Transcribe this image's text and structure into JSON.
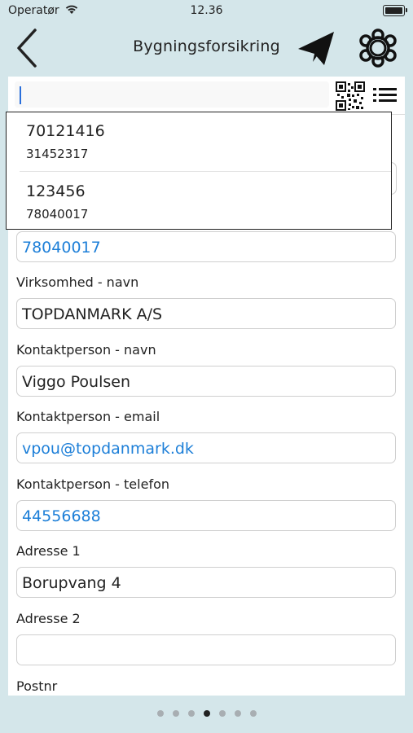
{
  "status_bar": {
    "carrier": "Operatør",
    "time": "12.36"
  },
  "nav": {
    "title": "Bygningsforsikring",
    "back_icon": "chevron-left-icon",
    "send_icon": "paper-plane-icon",
    "settings_icon": "gear-icon"
  },
  "search": {
    "value": "",
    "qr_icon": "qr-code-icon",
    "list_icon": "list-icon"
  },
  "dropdown": {
    "items": [
      {
        "main": "70121416",
        "sub": "31452317"
      },
      {
        "main": "123456",
        "sub": "78040017"
      }
    ]
  },
  "form": {
    "cvr_value": "78040017",
    "company_name_label": "Virksomhed - navn",
    "company_name_value": "TOPDANMARK A/S",
    "contact_name_label": "Kontaktperson - navn",
    "contact_name_value": "Viggo Poulsen",
    "contact_email_label": "Kontaktperson - email",
    "contact_email_value": "vpou@topdanmark.dk",
    "contact_phone_label": "Kontaktperson - telefon",
    "contact_phone_value": "44556688",
    "address1_label": "Adresse 1",
    "address1_value": "Borupvang 4",
    "address2_label": "Adresse 2",
    "address2_value": "",
    "postnr_label": "Postnr"
  },
  "page_indicator": {
    "total": 7,
    "current": 4
  },
  "colors": {
    "background": "#d4e6ea",
    "link_blue": "#1d7fd8",
    "caret_blue": "#2a6fdb"
  }
}
